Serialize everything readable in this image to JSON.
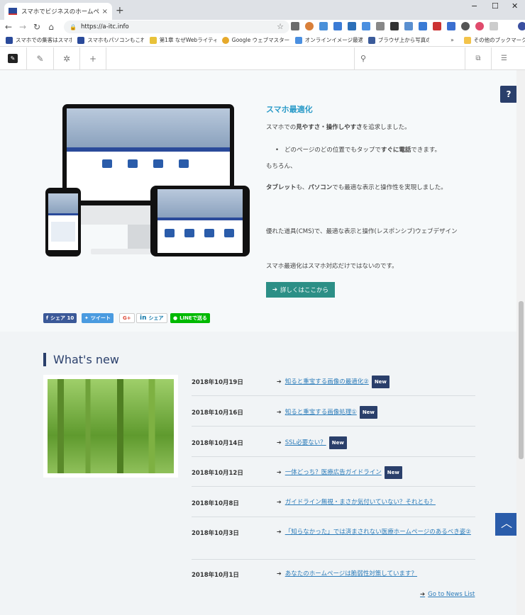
{
  "browser": {
    "tab_title": "スマホでビジネスのホームページ対応で",
    "tab_close": "×",
    "new_tab": "+",
    "window_minimize": "−",
    "window_maximize": "☐",
    "window_close": "✕",
    "url": "https://a-itc.info"
  },
  "bookmarks": {
    "items": [
      "スマホでの集客はスマホ",
      "スマホもパソコンもこれ",
      "第1章 なぜWebライティ",
      "Google ウェブマスターツ",
      "オンラインイメージ最適化",
      "ブラウザ上から写真の"
    ],
    "chevron": "»",
    "other": "その他のブックマーク"
  },
  "feature": {
    "title": "スマホ最適化",
    "p1_pre": "スマホでの",
    "p1_bold": "見やすさ・操作しやすさ",
    "p1_post": "を追求しました。",
    "bullet_pre": "どのページのどの位置でもタップで",
    "bullet_bold": "すぐに電話",
    "bullet_post": "できます。",
    "p2": "もちろん、",
    "p3_b1": "タブレット",
    "p3_m1": "も、",
    "p3_b2": "パソコン",
    "p3_post": "でも最適な表示と操作性を実現しました。",
    "p4": "優れた道具(CMS)で、最適な表示と操作(レスポンシブ)ウェブデザイン",
    "p5": "スマホ最適化はスマホ対応だけではないのです。",
    "button": "詳しくはここから"
  },
  "share": {
    "facebook": "シェア 10",
    "twitter": "ツイート",
    "google": "G+",
    "linkedin": "シェア",
    "line": "LINEで送る"
  },
  "whats_new": {
    "title": "What's new",
    "badge": "New",
    "items": [
      {
        "date": "2018年10月19日",
        "title": "知ると重宝する画像の最適化②",
        "new": true
      },
      {
        "date": "2018年10月16日",
        "title": "知ると重宝する画像処理①",
        "new": true
      },
      {
        "date": "2018年10月14日",
        "title": "SSL必要ない？",
        "new": true
      },
      {
        "date": "2018年10月12日",
        "title": "一体どっち？医療広告ガイドライン",
        "new": true
      },
      {
        "date": "2018年10月8日",
        "title": "ガイドライン無視・まさか気付いていない？それとも？",
        "new": false
      },
      {
        "date": "2018年10月3日",
        "title": "「知らなかった」では済まされない医療ホームページのあるべき姿②",
        "new": false
      },
      {
        "date": "2018年10月1日",
        "title": "あなたのホームページは脆弱性対策しています？",
        "new": false
      }
    ],
    "goto_list": "Go to News List"
  },
  "icons": {
    "help": "?",
    "to_top": "chevron-up-icon",
    "search": "search-icon"
  }
}
